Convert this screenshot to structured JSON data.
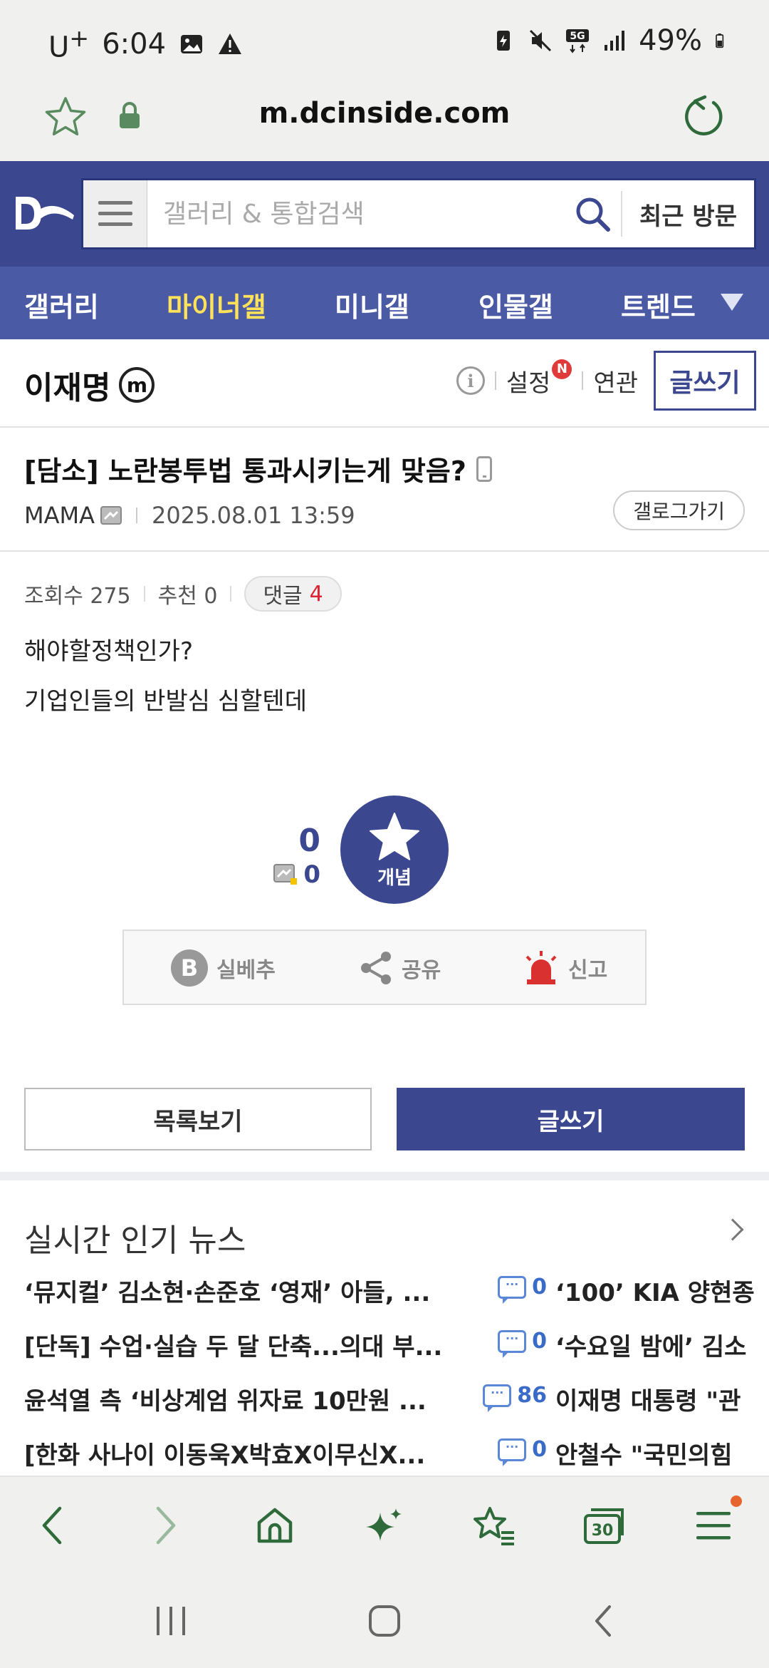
{
  "status": {
    "carrier": "U",
    "carrier_sup": "+",
    "time": "6:04",
    "battery": "49%"
  },
  "browser": {
    "url": "m.dcinside.com"
  },
  "header": {
    "search_placeholder": "갤러리 & 통합검색",
    "recent_label": "최근 방문"
  },
  "tabs": [
    {
      "label": "갤러리",
      "active": false
    },
    {
      "label": "마이너갤",
      "active": true
    },
    {
      "label": "미니갤",
      "active": false
    },
    {
      "label": "인물갤",
      "active": false
    },
    {
      "label": "트렌드",
      "active": false
    }
  ],
  "gallery": {
    "name": "이재명",
    "badge": "m",
    "settings_label": "설정",
    "settings_badge": "N",
    "related_label": "연관",
    "write_label": "글쓰기"
  },
  "post": {
    "title": "[담소] 노란봉투법 통과시키는게 맞음?",
    "author": "MAMA",
    "date": "2025.08.01 13:59",
    "gallog_label": "갤로그가기",
    "views_label": "조회수 275",
    "recommend_label": "추천 0",
    "comments_label": "댓글",
    "comments_count": "4",
    "body": [
      "해야할정책인가?",
      "기업인들의 반발심 심할텐데"
    ]
  },
  "recommend": {
    "count": "0",
    "fixed_count": "0",
    "button_label": "개념"
  },
  "actions": {
    "bad": "실베추",
    "share": "공유",
    "report": "신고"
  },
  "bottom_buttons": {
    "list": "목록보기",
    "write": "글쓰기"
  },
  "news": {
    "title": "실시간 인기 뉴스",
    "items": [
      {
        "headline": "‘뮤지컬’ 김소현·손준호 ‘영재’ 아들, ...",
        "comments": "0",
        "right": "‘100’ KIA 양현종"
      },
      {
        "headline": "[단독] 수업·실습 두 달 단축...의대 부...",
        "comments": "0",
        "right": "‘수요일 밤에’ 김소"
      },
      {
        "headline": "윤석열 측 ‘비상계엄 위자료 10만원 ...",
        "comments": "86",
        "right": "이재명 대통령 \"관"
      },
      {
        "headline": "[한화 사나이 이동욱X박효X이무신X...",
        "comments": "0",
        "right": "안철수 \"국민의힘"
      }
    ]
  },
  "toolbar": {
    "tabs_count": "30"
  },
  "colors": {
    "brand": "#3b4890",
    "tabbar": "#4b5aa5",
    "active_tab": "#ffe15a",
    "browser_green": "#2f6b3a"
  }
}
